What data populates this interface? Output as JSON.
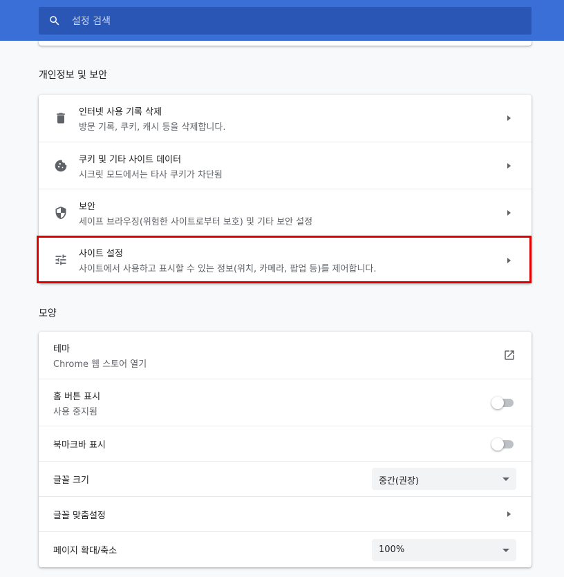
{
  "search": {
    "placeholder": "설정 검색"
  },
  "privacy": {
    "title": "개인정보 및 보안",
    "items": [
      {
        "icon": "trash-icon",
        "title": "인터넷 사용 기록 삭제",
        "subtitle": "방문 기록, 쿠키, 캐시 등을 삭제합니다."
      },
      {
        "icon": "cookie-icon",
        "title": "쿠키 및 기타 사이트 데이터",
        "subtitle": "시크릿 모드에서는 타사 쿠키가 차단됨"
      },
      {
        "icon": "shield-icon",
        "title": "보안",
        "subtitle": "세이프 브라우징(위험한 사이트로부터 보호) 및 기타 보안 설정"
      },
      {
        "icon": "tune-icon",
        "title": "사이트 설정",
        "subtitle": "사이트에서 사용하고 표시할 수 있는 정보(위치, 카메라, 팝업 등)를 제어합니다."
      }
    ]
  },
  "appearance": {
    "title": "모양",
    "theme": {
      "title": "테마",
      "subtitle": "Chrome 웹 스토어 열기"
    },
    "home_button": {
      "title": "홈 버튼 표시",
      "subtitle": "사용 중지됨",
      "enabled": false
    },
    "bookmarks_bar": {
      "title": "북마크바 표시",
      "enabled": false
    },
    "font_size": {
      "title": "글꼴 크기",
      "value": "중간(권장)"
    },
    "custom_fonts": {
      "title": "글꼴 맞춤설정"
    },
    "page_zoom": {
      "title": "페이지 확대/축소",
      "value": "100%"
    }
  },
  "colors": {
    "accent": "#3a6fd8",
    "highlight": "#e00000"
  }
}
